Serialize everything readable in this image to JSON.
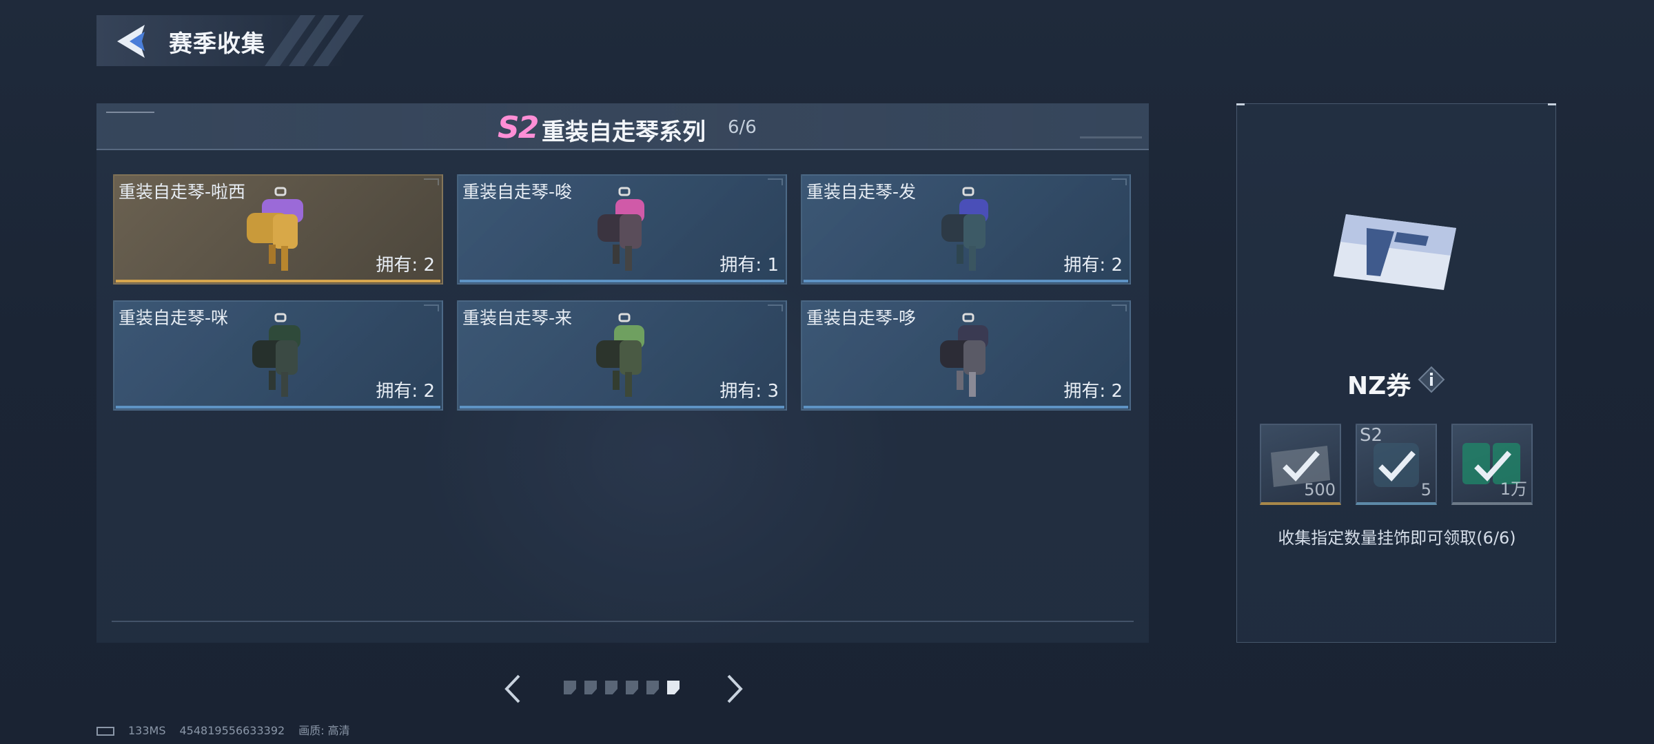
{
  "header": {
    "title": "赛季收集"
  },
  "series": {
    "badge": "S2",
    "title": "重装自走琴系列",
    "progress": "6/6"
  },
  "cards": [
    {
      "name": "重装自走琴-啦西",
      "owned": "拥有: 2",
      "rarity": "gold",
      "accent": "#9b6ad8"
    },
    {
      "name": "重装自走琴-唆",
      "owned": "拥有: 1",
      "rarity": "blue",
      "accent": "#d05aa8"
    },
    {
      "name": "重装自走琴-发",
      "owned": "拥有: 2",
      "rarity": "blue",
      "accent": "#4a4fb8"
    },
    {
      "name": "重装自走琴-咪",
      "owned": "拥有: 2",
      "rarity": "blue",
      "accent": "#2f4a3a"
    },
    {
      "name": "重装自走琴-来",
      "owned": "拥有: 3",
      "rarity": "blue",
      "accent": "#6fa060"
    },
    {
      "name": "重装自走琴-哆",
      "owned": "拥有: 2",
      "rarity": "blue",
      "accent": "#3a3a52"
    }
  ],
  "pagination": {
    "total": 6,
    "active_index": 5
  },
  "reward": {
    "name": "NZ券",
    "slots": [
      {
        "icon": "ticket-icon",
        "qty": "500",
        "tier": "gold",
        "claimed": true
      },
      {
        "icon": "s2-box-icon",
        "label": "S2",
        "qty": "5",
        "tier": "teal",
        "claimed": true
      },
      {
        "icon": "cp-icon",
        "qty": "1万",
        "tier": "grey",
        "claimed": true
      }
    ],
    "caption": "收集指定数量挂饰即可领取(6/6)"
  },
  "footer": {
    "ping": "133MS",
    "uid": "454819556633392",
    "quality": "画质: 高清"
  },
  "colors": {
    "gold_bar": "#d6a64e",
    "blue_bar": "#5e93c4",
    "badge_pink": "#ff8fd6"
  }
}
